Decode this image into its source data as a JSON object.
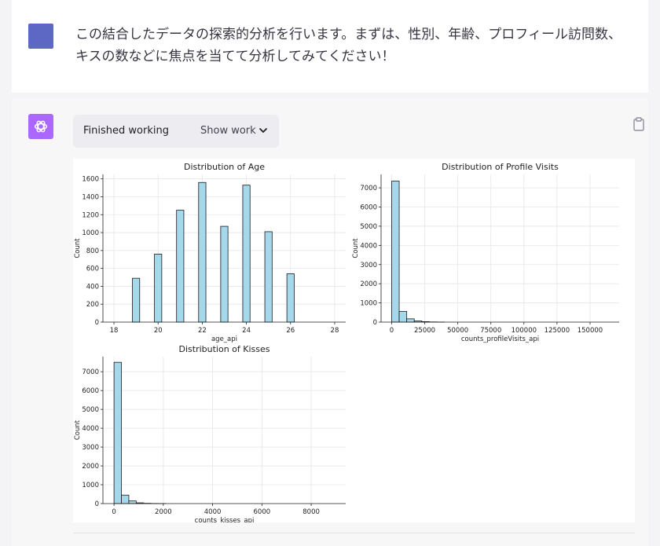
{
  "user_message": {
    "text": "この結合したデータの探索的分析を行います。まずは、性別、年齢、プロフィール訪問数、キスの数などに焦点を当てて分析してみてください！"
  },
  "assistant": {
    "status": "Finished working",
    "show_work_label": "Show work"
  },
  "colors": {
    "bar_fill": "#a6d8ec",
    "bar_stroke": "#1a1a1a",
    "user_avatar": "#5d67c4",
    "gpt_avatar": "#ab68ff"
  },
  "chart_data": [
    {
      "type": "bar",
      "title": "Distribution of Age",
      "xlabel": "age_api",
      "ylabel": "Count",
      "xlim": [
        17.5,
        28.5
      ],
      "ylim": [
        0,
        1650
      ],
      "xticks": [
        18,
        20,
        22,
        24,
        26,
        28
      ],
      "yticks": [
        0,
        200,
        400,
        600,
        800,
        1000,
        1200,
        1400,
        1600
      ],
      "bin_width": 0.33,
      "x": [
        19,
        20,
        21,
        22,
        23,
        24,
        25,
        26
      ],
      "values": [
        490,
        760,
        1250,
        1560,
        1070,
        1530,
        1010,
        540
      ]
    },
    {
      "type": "bar",
      "title": "Distribution of Profile Visits",
      "xlabel": "counts_profileVisits_api",
      "ylabel": "Count",
      "xlim": [
        -8000,
        172000
      ],
      "ylim": [
        0,
        7700
      ],
      "xticks": [
        0,
        25000,
        50000,
        75000,
        100000,
        125000,
        150000
      ],
      "yticks": [
        0,
        1000,
        2000,
        3000,
        4000,
        5000,
        6000,
        7000
      ],
      "bin_start": 0,
      "bin_width": 5700,
      "values": [
        7350,
        560,
        170,
        60,
        25,
        10,
        5
      ]
    },
    {
      "type": "bar",
      "title": "Distribution of Kisses",
      "xlabel": "counts_kisses_api",
      "ylabel": "Count",
      "xlim": [
        -450,
        9400
      ],
      "ylim": [
        0,
        7800
      ],
      "xticks": [
        0,
        2000,
        4000,
        6000,
        8000
      ],
      "yticks": [
        0,
        1000,
        2000,
        3000,
        4000,
        5000,
        6000,
        7000
      ],
      "bin_start": 0,
      "bin_width": 300,
      "values": [
        7500,
        450,
        140,
        40,
        15,
        6,
        3
      ]
    }
  ]
}
